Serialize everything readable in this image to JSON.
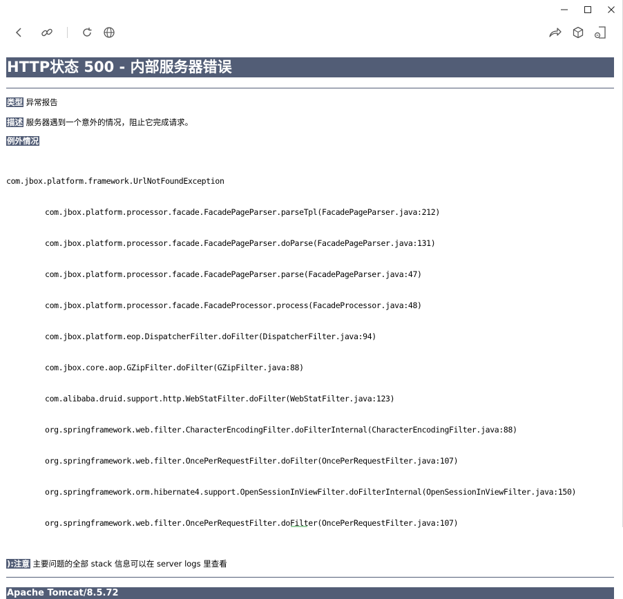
{
  "window": {
    "minimize": "—",
    "maximize": "☐",
    "close": "✕"
  },
  "toolbar": {
    "left_icons": [
      "back-icon",
      "link-icon",
      "reload-icon",
      "globe-icon"
    ],
    "right_icons": [
      "share-icon",
      "cube-icon",
      "export-icon"
    ]
  },
  "page": {
    "title": "HTTP状态 500 - 内部服务器错误",
    "type_label": "类型",
    "type_value": "异常报告",
    "desc_label": "描述",
    "desc_value": "服务器遇到一个意外的情况，阻止它完成请求。",
    "exception_label": "例外情况",
    "exception_name": "com.jbox.platform.framework.UrlNotFoundException",
    "stack_frames": [
      "com.jbox.platform.processor.facade.FacadePageParser.parseTpl(FacadePageParser.java:212)",
      "com.jbox.platform.processor.facade.FacadePageParser.doParse(FacadePageParser.java:131)",
      "com.jbox.platform.processor.facade.FacadePageParser.parse(FacadePageParser.java:47)",
      "com.jbox.platform.processor.facade.FacadeProcessor.process(FacadeProcessor.java:48)",
      "com.jbox.platform.eop.DispatcherFilter.doFilter(DispatcherFilter.java:94)",
      "com.jbox.core.aop.GZipFilter.doFilter(GZipFilter.java:88)",
      "com.alibaba.druid.support.http.WebStatFilter.doFilter(WebStatFilter.java:123)",
      "org.springframework.web.filter.CharacterEncodingFilter.doFilterInternal(CharacterEncodingFilter.java:88)",
      "org.springframework.web.filter.OncePerRequestFilter.doFilter(OncePerRequestFilter.java:107)",
      "org.springframework.orm.hibernate4.support.OpenSessionInViewFilter.doFilterInternal(OpenSessionInViewFilter.java:150)",
      "org.springframework.web.filter.OncePerRequestFilter.doFilter(OncePerRequestFilter.java:107)"
    ],
    "note_label": "):注意",
    "note_value": "主要问题的全部 stack 信息可以在 server logs 里查看",
    "footer": "Apache Tomcat/8.5.72"
  },
  "colors": {
    "header_bg": "#525d76",
    "header_text": "#ffffff"
  }
}
